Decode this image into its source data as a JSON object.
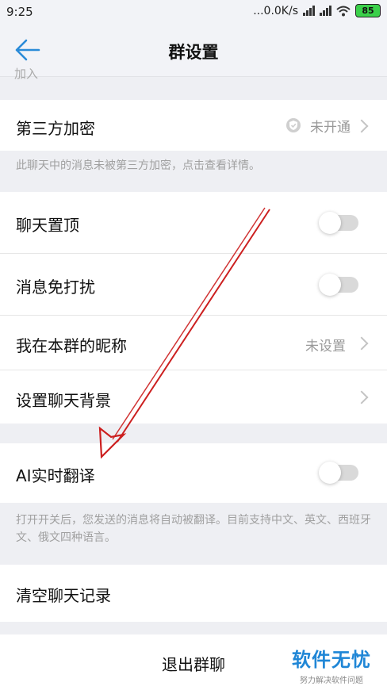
{
  "status_bar": {
    "time": "9:25",
    "network_speed": "...0.0K/s",
    "battery": "85"
  },
  "header": {
    "title": "群设置"
  },
  "cut_off_text": "加入",
  "third_party_encryption": {
    "label": "第三方加密",
    "status": "未开通",
    "hint": "此聊天中的消息未被第三方加密，点击查看详情。"
  },
  "pin_chat": {
    "label": "聊天置顶",
    "on": false
  },
  "do_not_disturb": {
    "label": "消息免打扰",
    "on": false
  },
  "group_nickname": {
    "label": "我在本群的昵称",
    "value": "未设置"
  },
  "chat_background": {
    "label": "设置聊天背景"
  },
  "ai_translate": {
    "label": "AI实时翻译",
    "on": false,
    "hint": "打开开关后，您发送的消息将自动被翻译。目前支持中文、英文、西班牙文、俄文四种语言。"
  },
  "clear_history": {
    "label": "清空聊天记录"
  },
  "exit_group": {
    "label": "退出群聊"
  },
  "watermark": {
    "main": "软件无忧",
    "sub": "努力解决软件问题"
  },
  "colors": {
    "accent": "#1f86d6",
    "annotation_arrow": "#cc1f1f",
    "background": "#eeeff3"
  }
}
